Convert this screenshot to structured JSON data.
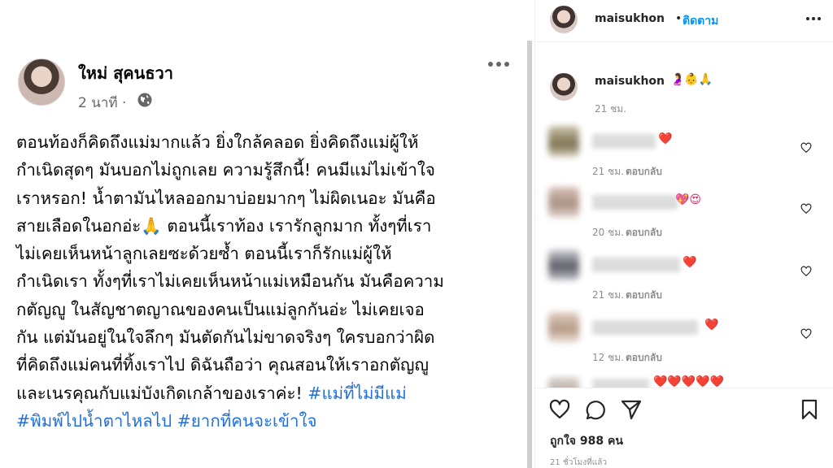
{
  "facebook": {
    "author": "ใหม่ สุคนธวา",
    "time": "2 นาที ·",
    "lines": [
      {
        "text": "ตอนท้องก็คิดถึงแม่มากแล้ว ยิ่งใกล้คลอด ยิ่งคิดถึงแม่ผู้ให้"
      },
      {
        "text": "กำเนิดสุดๆ มันบอกไม่ถูกเลย ความรู้สึกนี้! คนมีแม่ไม่เข้าใจ"
      },
      {
        "text": "เราหรอก! น้ำตามันไหลออกมาบ่อยมากๆ ไม่ผิดเนอะ มันคือ"
      },
      {
        "text": "สายเลือดในอกอ่ะ🙏 ตอนนี้เราท้อง เรารักลูกมาก ทั้งๆที่เรา"
      },
      {
        "text": "ไม่เคยเห็นหน้าลูกเลยซะด้วยซ้ำ ตอนนี้เราก็รักแม่ผู้ให้"
      },
      {
        "text": "กำเนิดเรา ทั้งๆที่เราไม่เคยเห็นหน้าแม่เหมือนกัน มันคือความ"
      },
      {
        "text": "กตัญญู ในสัญชาตญาณของคนเป็นแม่ลูกกันอ่ะ ไม่เคยเจอ"
      },
      {
        "text": "กัน แต่มันอยู่ในใจลึกๆ มันตัดกันไม่ขาดจริงๆ ใครบอกว่าผิด"
      },
      {
        "text": "ที่คิดถึงแม่คนที่ทิ้งเราไป ดิฉันถือว่า คุณสอนให้เราอกตัญญู"
      },
      {
        "text": "และเนรคุณกับแม่บังเกิดเกล้าของเราค่ะ! ",
        "tag": "#แม่ที่ไม่มีแม่"
      },
      {
        "text": "",
        "tag": "#พิมพ์ไปน้ำตาไหลไป #ยากที่คนจะเข้าใจ"
      }
    ]
  },
  "instagram": {
    "username": "maisukhon",
    "separator": "•",
    "follow_label": "ติดตาม",
    "caption_emoji": "🤰👶🙏",
    "caption_time": "21 ชม.",
    "reply_label": "ตอบกลับ",
    "comments": [
      {
        "time": "21 ชม.",
        "emoji": "❤️"
      },
      {
        "time": "20 ชม.",
        "emoji": "💖😍"
      },
      {
        "time": "21 ชม.",
        "emoji": "❤️"
      },
      {
        "time": "12 ชม.",
        "emoji": "❤️"
      },
      {
        "time": "",
        "emoji": "❤️❤️❤️❤️❤️"
      }
    ],
    "likes": "ถูกใจ 988 คน",
    "posted": "21 ชั่วโมงที่แล้ว"
  },
  "colors": {
    "hashtag": "#216fdb",
    "follow": "#0095f6",
    "heart": "#e0245e"
  }
}
